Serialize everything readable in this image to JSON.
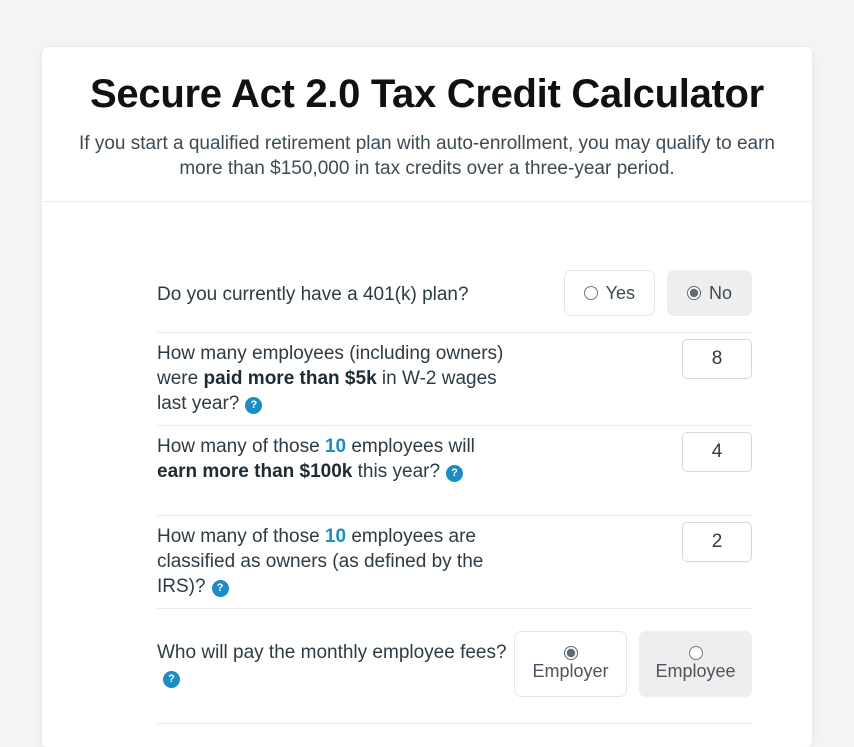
{
  "header": {
    "title": "Secure Act 2.0 Tax Credit Calculator",
    "subtitle": "If you start a qualified retirement plan with auto-enrollment, you may qualify to earn more than $150,000 in tax credits over a three-year period."
  },
  "colors": {
    "accent_blue": "#1b8dc4",
    "text_dark": "#2d3b45",
    "page_background": "#f4f4f4",
    "card_background": "#ffffff",
    "selected_pill_background": "#eeeeee"
  },
  "icons": {
    "help": "?"
  },
  "questions": [
    {
      "id": "has-401k",
      "text_parts": [
        {
          "text": "Do you currently have a 401(k) plan?",
          "style": "normal"
        }
      ],
      "has_help_icon": false,
      "control": "radio-inline",
      "options": [
        {
          "label": "Yes",
          "selected": false,
          "highlighted": false
        },
        {
          "label": "No",
          "selected": true,
          "highlighted": true
        }
      ]
    },
    {
      "id": "employees-paid-5k",
      "text_parts": [
        {
          "text": "How many employees (including owners) were ",
          "style": "normal"
        },
        {
          "text": "paid more than $5k",
          "style": "bold"
        },
        {
          "text": " in W-2 wages last year?",
          "style": "normal"
        }
      ],
      "has_help_icon": true,
      "control": "number",
      "value": "8"
    },
    {
      "id": "employees-earn-100k",
      "text_parts": [
        {
          "text": "How many of those ",
          "style": "normal"
        },
        {
          "text": "10",
          "style": "highlight"
        },
        {
          "text": " employees will ",
          "style": "normal"
        },
        {
          "text": "earn more than $100k",
          "style": "bold"
        },
        {
          "text": " this year?",
          "style": "normal"
        }
      ],
      "has_help_icon": true,
      "control": "number",
      "value": "4"
    },
    {
      "id": "employees-owners",
      "text_parts": [
        {
          "text": "How many of those ",
          "style": "normal"
        },
        {
          "text": "10",
          "style": "highlight"
        },
        {
          "text": " employees are classified as owners (as defined by the IRS)?",
          "style": "normal"
        }
      ],
      "has_help_icon": true,
      "control": "number",
      "value": "2"
    },
    {
      "id": "who-pays-fees",
      "text_parts": [
        {
          "text": "Who will pay the monthly employee fees?",
          "style": "normal"
        }
      ],
      "has_help_icon": true,
      "control": "radio-stacked",
      "options": [
        {
          "label": "Employer",
          "selected": true,
          "highlighted": false
        },
        {
          "label": "Employee",
          "selected": false,
          "highlighted": true
        }
      ]
    }
  ]
}
